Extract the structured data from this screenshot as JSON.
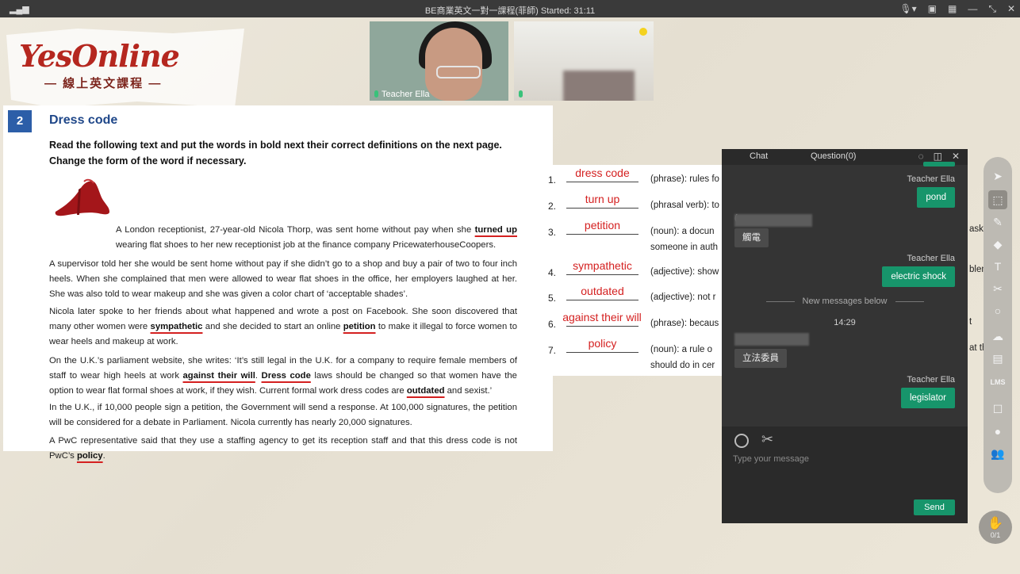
{
  "titlebar": {
    "title": "BE商業英文一對一課程(菲師)   Started: 31:11",
    "signal_icon": "signal-icon",
    "icons": [
      "mic-icon",
      "camera-icon",
      "layout-icon",
      "minimize-icon",
      "fullscreen-icon",
      "close-icon"
    ]
  },
  "logo": {
    "main": "YesOnline",
    "sub": "— 線上英文課程 —"
  },
  "videos": [
    {
      "name": "Teacher Ella"
    },
    {
      "name": ""
    }
  ],
  "worksheet": {
    "number": "2",
    "title": "Dress code",
    "instructions": "Read the following text and put the words in bold next their correct definitions on the next page. Change the form of the word if necessary.",
    "p1": {
      "a": "A London receptionist, 27-year-old Nicola Thorp, was sent home without pay when she ",
      "b": "turned up",
      "c": " wearing flat shoes to her new receptionist job at the finance company PricewaterhouseCoopers."
    },
    "p2": "A supervisor told her she would be sent home without pay if she didn’t go to a shop and buy a pair of two to four inch heels. When she complained that men were allowed to wear flat shoes in the office, her employers laughed at her. She was also told to wear makeup and she was given a color chart of ‘acceptable shades’.",
    "p3": {
      "a": "Nicola later spoke to her friends about what happened and wrote a post on Facebook. She soon discovered that many other women were ",
      "b": "sympathetic",
      "c": " and she decided to start an online ",
      "d": "petition",
      "e": " to make it illegal to force women to wear heels and makeup at work."
    },
    "p4": {
      "a": "On the U.K.’s parliament website, she writes: ‘It’s still legal in the U.K. for a company to require female members of staff to wear high heels at work ",
      "b": "against their will",
      "c": ". ",
      "d": "Dress code",
      "e": " laws should be changed so that women have the option to wear flat formal shoes at work, if they wish. Current formal work dress codes are ",
      "f": "outdated",
      "g": " and sexist.’"
    },
    "p5": "In the U.K., if 10,000 people sign a petition, the Government will send a response.  At 100,000 signatures, the petition will be considered for a debate in Parliament. Nicola currently has nearly 20,000 signatures.",
    "p6": {
      "a": "A PwC representative said that they use a staffing agency to get its reception staff and that this dress code is not PwC’s ",
      "b": "policy",
      "c": "."
    }
  },
  "definitions": [
    {
      "num": "1.",
      "answer": "dress code",
      "text": "(phrase): rules fo",
      "text2": ""
    },
    {
      "num": "2.",
      "answer": "turn up",
      "text": "(phrasal verb): to",
      "text2": ""
    },
    {
      "num": "3.",
      "answer": "petition",
      "text": "(noun):  a docun",
      "text2": "someone in auth"
    },
    {
      "num": "4.",
      "answer": "sympathetic",
      "text": "(adjective): show",
      "text2": ""
    },
    {
      "num": "5.",
      "answer": "outdated",
      "text": "(adjective): not r",
      "text2": ""
    },
    {
      "num": "6.",
      "answer": "against their will",
      "text": "(phrase): becaus",
      "text2": ""
    },
    {
      "num": "7.",
      "answer": "policy",
      "text": "(noun):  a rule o",
      "text2": "should do in cer"
    }
  ],
  "definition_peeks": [
    "asking",
    "blems",
    "t",
    "at they"
  ],
  "chat": {
    "tab_chat": "Chat",
    "tab_question": "Question(0)",
    "header_icons": [
      "bubble-icon",
      "popout-icon",
      "close-icon"
    ],
    "messages": [
      {
        "sender": "Teacher Ella",
        "text": "pond"
      },
      {
        "sender": "",
        "text": "觸電"
      },
      {
        "sender": "Teacher Ella",
        "text": "electric shock"
      },
      {
        "sender": "",
        "text": "立法委員"
      },
      {
        "sender": "Teacher Ella",
        "text": "legislator"
      }
    ],
    "partial_bracket": "(",
    "new_messages": "New messages below",
    "time": "14:29",
    "placeholder": "Type your message",
    "send": "Send"
  },
  "toolbar": {
    "lms_label": "LMS",
    "icons": [
      "pointer-icon",
      "select-icon",
      "pen-icon",
      "eraser-icon",
      "text-icon",
      "scissors-icon",
      "shape-icon",
      "cloud-icon",
      "toolbox-icon",
      "lms-icon",
      "edit-icon",
      "chat-icon",
      "users-icon"
    ]
  },
  "hand": {
    "count": "0/1"
  },
  "colors": {
    "accent_green": "#17956b",
    "answer_red": "#d42020",
    "title_blue": "#1f4789",
    "logo_red": "#b5271f"
  }
}
